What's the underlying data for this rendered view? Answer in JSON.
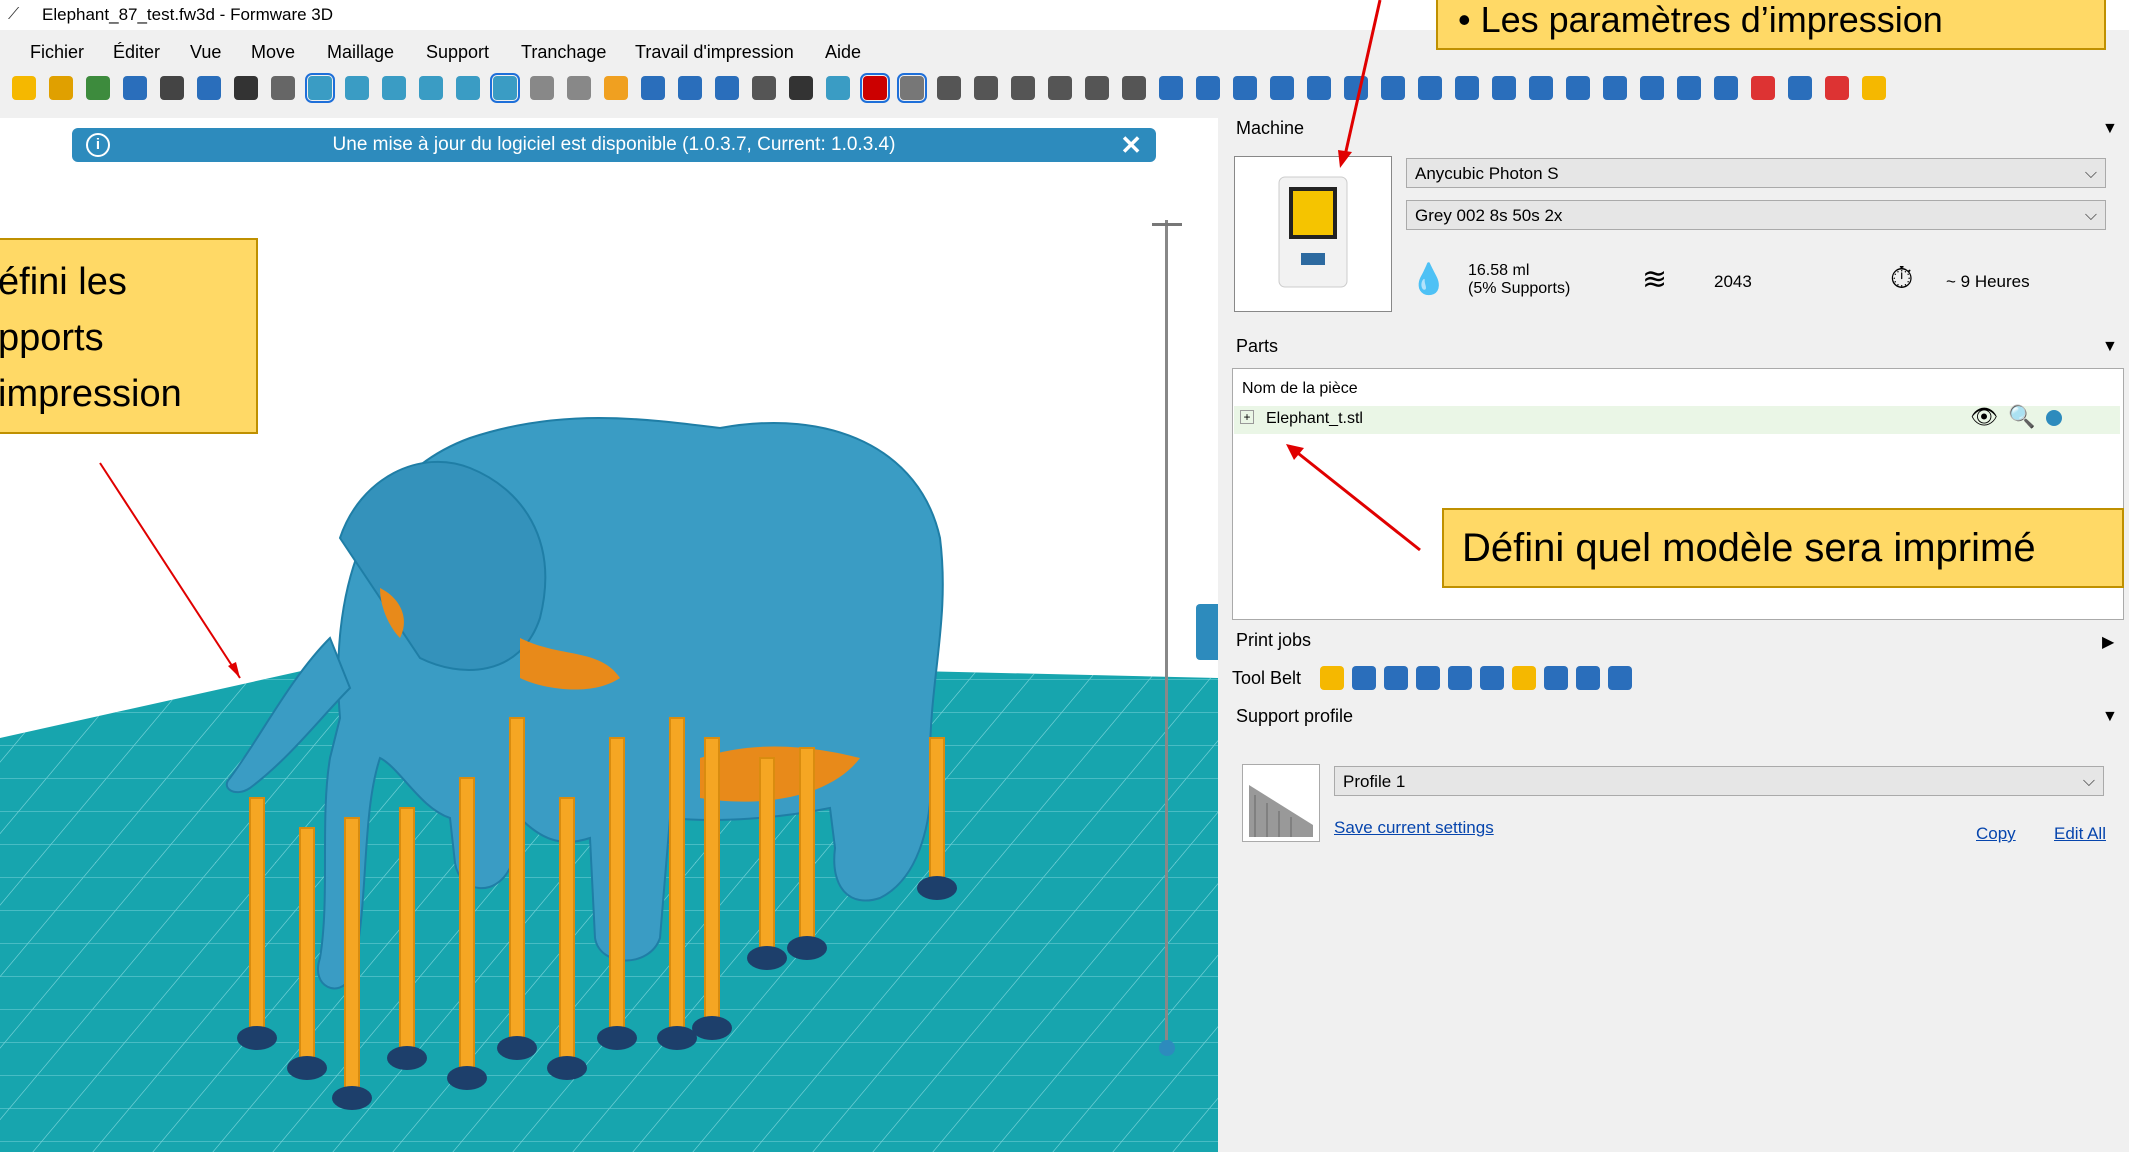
{
  "window": {
    "title": "Elephant_87_test.fw3d - Formware 3D"
  },
  "menu": [
    "Fichier",
    "Éditer",
    "Vue",
    "Move",
    "Maillage",
    "Support",
    "Tranchage",
    "Travail d'impression",
    "Aide"
  ],
  "banner": {
    "message": "Une mise à jour du logiciel est disponible  (1.0.3.7, Current: 1.0.3.4)",
    "info_glyph": "i",
    "close_glyph": "✕"
  },
  "machine": {
    "header": "Machine",
    "printer": "Anycubic Photon S",
    "profile": "Grey 002 8s 50s 2x",
    "volume_line1": "16.58 ml",
    "volume_line2": "(5% Supports)",
    "layers": "2043",
    "time": "~ 9 Heures"
  },
  "parts": {
    "header": "Parts",
    "column": "Nom de la pièce",
    "items": [
      {
        "name": "Elephant_t.stl"
      }
    ]
  },
  "print_jobs": {
    "header": "Print jobs"
  },
  "tool_belt": {
    "label": "Tool Belt"
  },
  "support_profile": {
    "header": "Support profile",
    "selected": "Profile 1",
    "save_link": "Save current settings",
    "copy_link": "Copy",
    "edit_link": "Edit All"
  },
  "callouts": {
    "top_right": "•    Les paramètres d’impression",
    "left_line1": "éfini les",
    "left_line2": "pports",
    "left_line3": "impression",
    "parts": "Défini quel modèle sera imprimé"
  },
  "colors": {
    "accent": "#2d8bbd",
    "model": "#3a9cc4",
    "support": "#f5a623",
    "bed": "#1aa7b0",
    "callout": "#ffd966"
  }
}
